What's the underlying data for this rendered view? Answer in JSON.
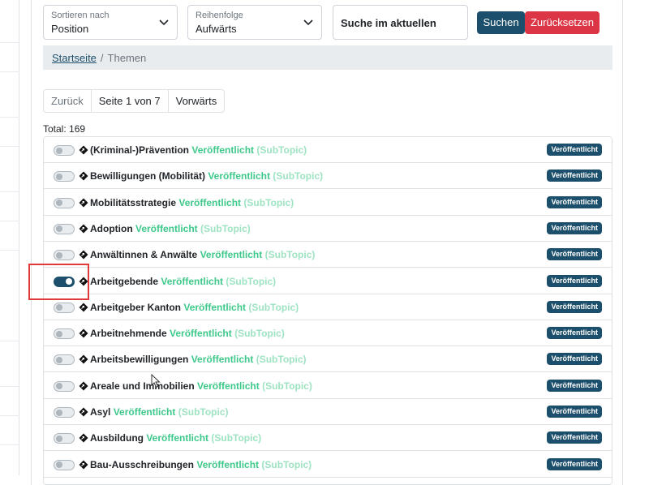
{
  "controls": {
    "sort": {
      "caption": "Sortieren nach",
      "value": "Position"
    },
    "order": {
      "caption": "Reihenfolge",
      "value": "Aufwärts"
    },
    "search_label": "Suche im aktuellen",
    "search_button": "Suchen",
    "reset_button": "Zurücksetzen"
  },
  "breadcrumb": {
    "home": "Startseite",
    "separator": "/",
    "current": "Themen"
  },
  "pager": {
    "prev": "Zurück",
    "current": "Seite 1 von 7",
    "next": "Vorwärts"
  },
  "total": "Total: 169",
  "colors": {
    "accent": "#1c4f6b",
    "danger": "#dc3545",
    "published": "#3ec98a"
  },
  "topics": [
    {
      "name": "(Kriminal-)Prävention",
      "status": "Veröffentlicht",
      "type": "(SubTopic)",
      "badge": "Veröffentlicht",
      "enabled": false
    },
    {
      "name": "Bewilligungen (Mobilität)",
      "status": "Veröffentlicht",
      "type": "(SubTopic)",
      "badge": "Veröffentlicht",
      "enabled": false
    },
    {
      "name": "Mobilitätsstrategie",
      "status": "Veröffentlicht",
      "type": "(SubTopic)",
      "badge": "Veröffentlicht",
      "enabled": false
    },
    {
      "name": "Adoption",
      "status": "Veröffentlicht",
      "type": "(SubTopic)",
      "badge": "Veröffentlicht",
      "enabled": false
    },
    {
      "name": "Anwältinnen & Anwälte",
      "status": "Veröffentlicht",
      "type": "(SubTopic)",
      "badge": "Veröffentlicht",
      "enabled": false
    },
    {
      "name": "Arbeitgebende",
      "status": "Veröffentlicht",
      "type": "(SubTopic)",
      "badge": "Veröffentlicht",
      "enabled": true
    },
    {
      "name": "Arbeitgeber Kanton",
      "status": "Veröffentlicht",
      "type": "(SubTopic)",
      "badge": "Veröffentlicht",
      "enabled": false
    },
    {
      "name": "Arbeitnehmende",
      "status": "Veröffentlicht",
      "type": "(SubTopic)",
      "badge": "Veröffentlicht",
      "enabled": false
    },
    {
      "name": "Arbeitsbewilligungen",
      "status": "Veröffentlicht",
      "type": "(SubTopic)",
      "badge": "Veröffentlicht",
      "enabled": false
    },
    {
      "name": "Areale und Immobilien",
      "status": "Veröffentlicht",
      "type": "(SubTopic)",
      "badge": "Veröffentlicht",
      "enabled": false
    },
    {
      "name": "Asyl",
      "status": "Veröffentlicht",
      "type": "(SubTopic)",
      "badge": "Veröffentlicht",
      "enabled": false
    },
    {
      "name": "Ausbildung",
      "status": "Veröffentlicht",
      "type": "(SubTopic)",
      "badge": "Veröffentlicht",
      "enabled": false
    },
    {
      "name": "Bau-Ausschreibungen",
      "status": "Veröffentlicht",
      "type": "(SubTopic)",
      "badge": "Veröffentlicht",
      "enabled": false
    }
  ]
}
